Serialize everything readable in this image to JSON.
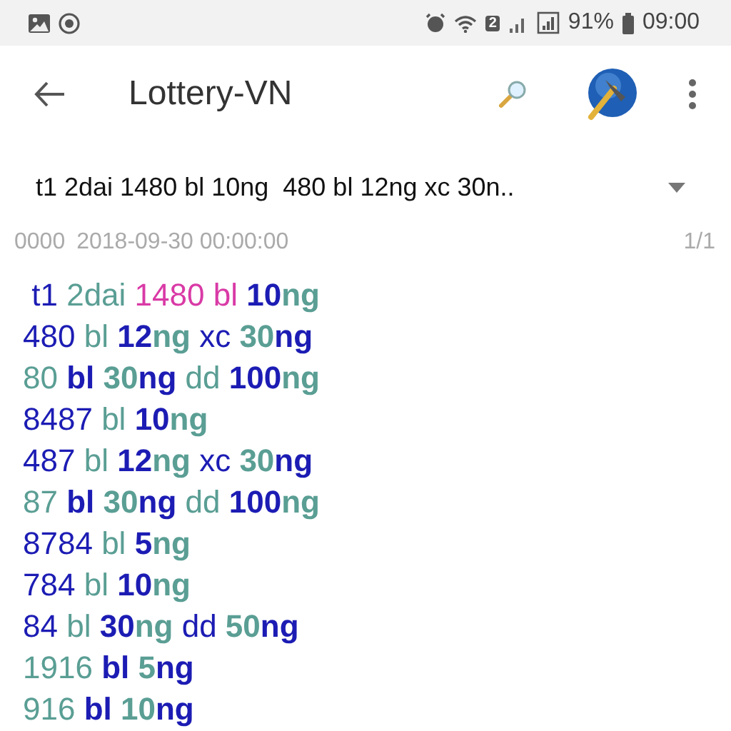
{
  "status_bar": {
    "battery": "91%",
    "time": "09:00",
    "sim_badge": "2"
  },
  "toolbar": {
    "title": "Lottery-VN"
  },
  "dropdown": {
    "value": "t1 2dai 1480 bl 10ng  480 bl 12ng xc 30n.."
  },
  "meta": {
    "code": "0000",
    "datetime": "2018-09-30 00:00:00",
    "page": "1/1"
  },
  "lines": [
    [
      {
        "text": " t1",
        "color": "#1c1cb4",
        "bold": false
      },
      {
        "text": " 2dai",
        "color": "#5a9e94",
        "bold": false
      },
      {
        "text": " 1480 bl",
        "color": "#d93aa6",
        "bold": false
      },
      {
        "text": " 10",
        "color": "#1c1cb4",
        "bold": true
      },
      {
        "text": "ng",
        "color": "#5a9e94",
        "bold": true
      }
    ],
    [
      {
        "text": "480",
        "color": "#1c1cb4",
        "bold": false
      },
      {
        "text": " bl",
        "color": "#5a9e94",
        "bold": false
      },
      {
        "text": " 12",
        "color": "#1c1cb4",
        "bold": true
      },
      {
        "text": "ng",
        "color": "#5a9e94",
        "bold": true
      },
      {
        "text": " xc",
        "color": "#1c1cb4",
        "bold": false
      },
      {
        "text": " 30",
        "color": "#5a9e94",
        "bold": true
      },
      {
        "text": "ng",
        "color": "#1c1cb4",
        "bold": true
      }
    ],
    [
      {
        "text": "80",
        "color": "#5a9e94",
        "bold": false
      },
      {
        "text": " bl",
        "color": "#1c1cb4",
        "bold": true
      },
      {
        "text": " 30",
        "color": "#5a9e94",
        "bold": true
      },
      {
        "text": "ng",
        "color": "#1c1cb4",
        "bold": true
      },
      {
        "text": " dd",
        "color": "#5a9e94",
        "bold": false
      },
      {
        "text": " 100",
        "color": "#1c1cb4",
        "bold": true
      },
      {
        "text": "ng",
        "color": "#5a9e94",
        "bold": true
      }
    ],
    [
      {
        "text": "8487",
        "color": "#1c1cb4",
        "bold": false
      },
      {
        "text": " bl",
        "color": "#5a9e94",
        "bold": false
      },
      {
        "text": " 10",
        "color": "#1c1cb4",
        "bold": true
      },
      {
        "text": "ng",
        "color": "#5a9e94",
        "bold": true
      }
    ],
    [
      {
        "text": "487",
        "color": "#1c1cb4",
        "bold": false
      },
      {
        "text": " bl",
        "color": "#5a9e94",
        "bold": false
      },
      {
        "text": " 12",
        "color": "#1c1cb4",
        "bold": true
      },
      {
        "text": "ng",
        "color": "#5a9e94",
        "bold": true
      },
      {
        "text": " xc",
        "color": "#1c1cb4",
        "bold": false
      },
      {
        "text": " 30",
        "color": "#5a9e94",
        "bold": true
      },
      {
        "text": "ng",
        "color": "#1c1cb4",
        "bold": true
      }
    ],
    [
      {
        "text": "87",
        "color": "#5a9e94",
        "bold": false
      },
      {
        "text": " bl",
        "color": "#1c1cb4",
        "bold": true
      },
      {
        "text": " 30",
        "color": "#5a9e94",
        "bold": true
      },
      {
        "text": "ng",
        "color": "#1c1cb4",
        "bold": true
      },
      {
        "text": " dd",
        "color": "#5a9e94",
        "bold": false
      },
      {
        "text": " 100",
        "color": "#1c1cb4",
        "bold": true
      },
      {
        "text": "ng",
        "color": "#5a9e94",
        "bold": true
      }
    ],
    [
      {
        "text": "8784",
        "color": "#1c1cb4",
        "bold": false
      },
      {
        "text": " bl",
        "color": "#5a9e94",
        "bold": false
      },
      {
        "text": " 5",
        "color": "#1c1cb4",
        "bold": true
      },
      {
        "text": "ng",
        "color": "#5a9e94",
        "bold": true
      }
    ],
    [
      {
        "text": "784",
        "color": "#1c1cb4",
        "bold": false
      },
      {
        "text": " bl",
        "color": "#5a9e94",
        "bold": false
      },
      {
        "text": " 10",
        "color": "#1c1cb4",
        "bold": true
      },
      {
        "text": "ng",
        "color": "#5a9e94",
        "bold": true
      }
    ],
    [
      {
        "text": "84",
        "color": "#1c1cb4",
        "bold": false
      },
      {
        "text": " bl",
        "color": "#5a9e94",
        "bold": false
      },
      {
        "text": " 30",
        "color": "#1c1cb4",
        "bold": true
      },
      {
        "text": "ng",
        "color": "#5a9e94",
        "bold": true
      },
      {
        "text": " dd",
        "color": "#1c1cb4",
        "bold": false
      },
      {
        "text": " 50",
        "color": "#5a9e94",
        "bold": true
      },
      {
        "text": "ng",
        "color": "#1c1cb4",
        "bold": true
      }
    ],
    [
      {
        "text": "1916",
        "color": "#5a9e94",
        "bold": false
      },
      {
        "text": " bl",
        "color": "#1c1cb4",
        "bold": true
      },
      {
        "text": " 5",
        "color": "#5a9e94",
        "bold": true
      },
      {
        "text": "ng",
        "color": "#1c1cb4",
        "bold": true
      }
    ],
    [
      {
        "text": "916",
        "color": "#5a9e94",
        "bold": false
      },
      {
        "text": " bl",
        "color": "#1c1cb4",
        "bold": true
      },
      {
        "text": " 10",
        "color": "#5a9e94",
        "bold": true
      },
      {
        "text": "ng",
        "color": "#1c1cb4",
        "bold": true
      }
    ]
  ]
}
